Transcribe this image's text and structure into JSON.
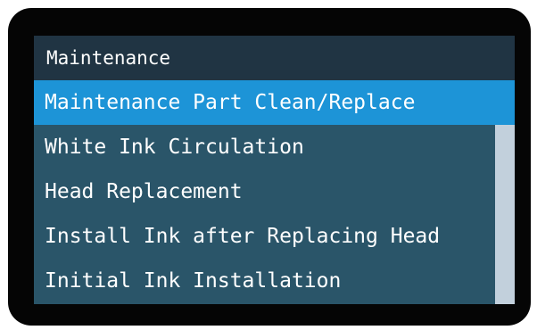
{
  "header": {
    "title": "Maintenance"
  },
  "menu": {
    "selected_index": 0,
    "items": [
      {
        "label": "Maintenance Part Clean/Replace"
      },
      {
        "label": "White Ink Circulation"
      },
      {
        "label": "Head Replacement"
      },
      {
        "label": "Install Ink after Replacing Head"
      },
      {
        "label": "Initial Ink Installation"
      }
    ]
  },
  "colors": {
    "bezel": "#050505",
    "header_bg": "#203443",
    "list_bg": "#2a5569",
    "selection": "#1d94d7",
    "scroll_track": "#c2d0dc",
    "text": "#ffffff"
  }
}
